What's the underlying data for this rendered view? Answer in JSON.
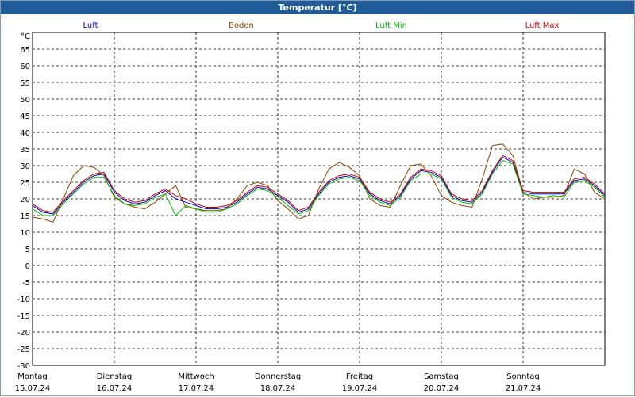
{
  "window": {
    "title": "Temperatur [°C]"
  },
  "chart_data": {
    "type": "line",
    "unit_label": "°C",
    "ylim": [
      -30,
      70
    ],
    "yticks": [
      65,
      60,
      55,
      50,
      45,
      40,
      35,
      30,
      25,
      20,
      15,
      10,
      5,
      0,
      -5,
      -10,
      -15,
      -20,
      -25,
      -30
    ],
    "xlim": [
      "2024-07-15",
      "2024-07-22"
    ],
    "x_ticks": [
      {
        "day": "Montag",
        "date": "15.07.24",
        "x": "2024-07-15"
      },
      {
        "day": "Dienstag",
        "date": "16.07.24",
        "x": "2024-07-16"
      },
      {
        "day": "Mittwoch",
        "date": "17.07.24",
        "x": "2024-07-17"
      },
      {
        "day": "Donnerstag",
        "date": "18.07.24",
        "x": "2024-07-18"
      },
      {
        "day": "Freitag",
        "date": "19.07.24",
        "x": "2024-07-19"
      },
      {
        "day": "Samstag",
        "date": "20.07.24",
        "x": "2024-07-20"
      },
      {
        "day": "Sonntag",
        "date": "21.07.24",
        "x": "2024-07-21"
      }
    ],
    "grid": true,
    "legend_position": "top",
    "series": [
      {
        "name": "Luft",
        "color": "#0000cc",
        "x": [
          "2024-07-15T00:00",
          "2024-07-15T03:00",
          "2024-07-15T06:00",
          "2024-07-15T09:00",
          "2024-07-15T12:00",
          "2024-07-15T15:00",
          "2024-07-15T18:00",
          "2024-07-15T21:00",
          "2024-07-16T00:00",
          "2024-07-16T03:00",
          "2024-07-16T06:00",
          "2024-07-16T09:00",
          "2024-07-16T12:00",
          "2024-07-16T15:00",
          "2024-07-16T18:00",
          "2024-07-16T21:00",
          "2024-07-17T00:00",
          "2024-07-17T03:00",
          "2024-07-17T06:00",
          "2024-07-17T09:00",
          "2024-07-17T12:00",
          "2024-07-17T15:00",
          "2024-07-17T18:00",
          "2024-07-17T21:00",
          "2024-07-18T00:00",
          "2024-07-18T03:00",
          "2024-07-18T06:00",
          "2024-07-18T09:00",
          "2024-07-18T12:00",
          "2024-07-18T15:00",
          "2024-07-18T18:00",
          "2024-07-18T21:00",
          "2024-07-19T00:00",
          "2024-07-19T03:00",
          "2024-07-19T06:00",
          "2024-07-19T09:00",
          "2024-07-19T12:00",
          "2024-07-19T15:00",
          "2024-07-19T18:00",
          "2024-07-19T21:00",
          "2024-07-20T00:00",
          "2024-07-20T03:00",
          "2024-07-20T06:00",
          "2024-07-20T09:00",
          "2024-07-20T12:00",
          "2024-07-20T15:00",
          "2024-07-20T18:00",
          "2024-07-20T21:00",
          "2024-07-21T00:00",
          "2024-07-21T03:00",
          "2024-07-21T06:00",
          "2024-07-21T09:00",
          "2024-07-21T12:00",
          "2024-07-21T15:00",
          "2024-07-21T18:00",
          "2024-07-21T21:00",
          "2024-07-22T00:00"
        ],
        "values": [
          18,
          16,
          15.5,
          19,
          22,
          25,
          27,
          27.5,
          22,
          19.5,
          18.5,
          19,
          21,
          22.5,
          20,
          19,
          18,
          17,
          17,
          17.5,
          19,
          21.5,
          23.5,
          23,
          21,
          19,
          16,
          17,
          21.5,
          25,
          26.5,
          27,
          26,
          21.5,
          19.5,
          18.5,
          21,
          26,
          28.5,
          28,
          26.5,
          21,
          19.5,
          19,
          22,
          28,
          32.5,
          31,
          22,
          21.5,
          21.5,
          21.5,
          21.5,
          25.5,
          26,
          24,
          21
        ]
      },
      {
        "name": "Boden",
        "color": "#8b4500",
        "x": [
          "2024-07-15T00:00",
          "2024-07-15T03:00",
          "2024-07-15T06:00",
          "2024-07-15T09:00",
          "2024-07-15T12:00",
          "2024-07-15T15:00",
          "2024-07-15T18:00",
          "2024-07-15T21:00",
          "2024-07-16T00:00",
          "2024-07-16T03:00",
          "2024-07-16T06:00",
          "2024-07-16T09:00",
          "2024-07-16T12:00",
          "2024-07-16T15:00",
          "2024-07-16T18:00",
          "2024-07-16T21:00",
          "2024-07-17T00:00",
          "2024-07-17T03:00",
          "2024-07-17T06:00",
          "2024-07-17T09:00",
          "2024-07-17T12:00",
          "2024-07-17T15:00",
          "2024-07-17T18:00",
          "2024-07-17T21:00",
          "2024-07-18T00:00",
          "2024-07-18T03:00",
          "2024-07-18T06:00",
          "2024-07-18T09:00",
          "2024-07-18T12:00",
          "2024-07-18T15:00",
          "2024-07-18T18:00",
          "2024-07-18T21:00",
          "2024-07-19T00:00",
          "2024-07-19T03:00",
          "2024-07-19T06:00",
          "2024-07-19T09:00",
          "2024-07-19T12:00",
          "2024-07-19T15:00",
          "2024-07-19T18:00",
          "2024-07-19T21:00",
          "2024-07-20T00:00",
          "2024-07-20T03:00",
          "2024-07-20T06:00",
          "2024-07-20T09:00",
          "2024-07-20T12:00",
          "2024-07-20T15:00",
          "2024-07-20T18:00",
          "2024-07-20T21:00",
          "2024-07-21T00:00",
          "2024-07-21T03:00",
          "2024-07-21T06:00",
          "2024-07-21T09:00",
          "2024-07-21T12:00",
          "2024-07-21T15:00",
          "2024-07-21T18:00",
          "2024-07-21T21:00",
          "2024-07-22T00:00"
        ],
        "values": [
          14.5,
          14,
          13,
          20,
          27,
          30,
          29.5,
          27,
          20.5,
          18.5,
          17.5,
          17,
          19,
          21.5,
          24,
          17.5,
          17,
          16.5,
          16.5,
          17,
          20,
          24,
          25,
          24,
          19.5,
          17,
          14,
          15,
          23,
          29,
          31,
          29.5,
          27,
          20,
          18,
          17.5,
          24,
          30,
          30.5,
          27,
          21,
          19,
          18,
          17.5,
          26,
          36,
          36.5,
          33,
          22,
          20,
          20.5,
          20.5,
          21,
          29,
          27.5,
          22,
          20
        ]
      },
      {
        "name": "Luft Min",
        "color": "#00bb00",
        "x": [
          "2024-07-15T00:00",
          "2024-07-15T03:00",
          "2024-07-15T06:00",
          "2024-07-15T09:00",
          "2024-07-15T12:00",
          "2024-07-15T15:00",
          "2024-07-15T18:00",
          "2024-07-15T21:00",
          "2024-07-16T00:00",
          "2024-07-16T03:00",
          "2024-07-16T06:00",
          "2024-07-16T09:00",
          "2024-07-16T12:00",
          "2024-07-16T15:00",
          "2024-07-16T18:00",
          "2024-07-16T21:00",
          "2024-07-17T00:00",
          "2024-07-17T03:00",
          "2024-07-17T06:00",
          "2024-07-17T09:00",
          "2024-07-17T12:00",
          "2024-07-17T15:00",
          "2024-07-17T18:00",
          "2024-07-17T21:00",
          "2024-07-18T00:00",
          "2024-07-18T03:00",
          "2024-07-18T06:00",
          "2024-07-18T09:00",
          "2024-07-18T12:00",
          "2024-07-18T15:00",
          "2024-07-18T18:00",
          "2024-07-18T21:00",
          "2024-07-19T00:00",
          "2024-07-19T03:00",
          "2024-07-19T06:00",
          "2024-07-19T09:00",
          "2024-07-19T12:00",
          "2024-07-19T15:00",
          "2024-07-19T18:00",
          "2024-07-19T21:00",
          "2024-07-20T00:00",
          "2024-07-20T03:00",
          "2024-07-20T06:00",
          "2024-07-20T09:00",
          "2024-07-20T12:00",
          "2024-07-20T15:00",
          "2024-07-20T18:00",
          "2024-07-20T21:00",
          "2024-07-21T00:00",
          "2024-07-21T03:00",
          "2024-07-21T06:00",
          "2024-07-21T09:00",
          "2024-07-21T12:00",
          "2024-07-21T15:00",
          "2024-07-21T18:00",
          "2024-07-21T21:00",
          "2024-07-22T00:00"
        ],
        "values": [
          17,
          15,
          15,
          18.5,
          21.5,
          24.5,
          26.5,
          26.5,
          21,
          18.5,
          18,
          18.5,
          20.5,
          21.5,
          15,
          18,
          17,
          16,
          16,
          17,
          18.5,
          21,
          23,
          22.5,
          20.5,
          18,
          15.5,
          16.5,
          21,
          24.5,
          26,
          26.5,
          25.5,
          21,
          19,
          18,
          20.5,
          25.5,
          27.5,
          27.5,
          26,
          20.5,
          19,
          18.5,
          21.5,
          27.5,
          31.5,
          30.5,
          21.5,
          21,
          20.5,
          21,
          20.5,
          25,
          25.5,
          23.5,
          20.5
        ]
      },
      {
        "name": "Luft Max",
        "color": "#cc0000",
        "x": [
          "2024-07-15T00:00",
          "2024-07-15T03:00",
          "2024-07-15T06:00",
          "2024-07-15T09:00",
          "2024-07-15T12:00",
          "2024-07-15T15:00",
          "2024-07-15T18:00",
          "2024-07-15T21:00",
          "2024-07-16T00:00",
          "2024-07-16T03:00",
          "2024-07-16T06:00",
          "2024-07-16T09:00",
          "2024-07-16T12:00",
          "2024-07-16T15:00",
          "2024-07-16T18:00",
          "2024-07-16T21:00",
          "2024-07-17T00:00",
          "2024-07-17T03:00",
          "2024-07-17T06:00",
          "2024-07-17T09:00",
          "2024-07-17T12:00",
          "2024-07-17T15:00",
          "2024-07-17T18:00",
          "2024-07-17T21:00",
          "2024-07-18T00:00",
          "2024-07-18T03:00",
          "2024-07-18T06:00",
          "2024-07-18T09:00",
          "2024-07-18T12:00",
          "2024-07-18T15:00",
          "2024-07-18T18:00",
          "2024-07-18T21:00",
          "2024-07-19T00:00",
          "2024-07-19T03:00",
          "2024-07-19T06:00",
          "2024-07-19T09:00",
          "2024-07-19T12:00",
          "2024-07-19T15:00",
          "2024-07-19T18:00",
          "2024-07-19T21:00",
          "2024-07-20T00:00",
          "2024-07-20T03:00",
          "2024-07-20T06:00",
          "2024-07-20T09:00",
          "2024-07-20T12:00",
          "2024-07-20T15:00",
          "2024-07-20T18:00",
          "2024-07-20T21:00",
          "2024-07-21T00:00",
          "2024-07-21T03:00",
          "2024-07-21T06:00",
          "2024-07-21T09:00",
          "2024-07-21T12:00",
          "2024-07-21T15:00",
          "2024-07-21T18:00",
          "2024-07-21T21:00",
          "2024-07-22T00:00"
        ],
        "values": [
          18.5,
          16.5,
          16,
          19.5,
          22.5,
          25.5,
          27.5,
          28,
          22.5,
          20,
          19,
          19.5,
          21.5,
          23,
          21,
          20,
          18.5,
          17.5,
          17.5,
          18,
          19.5,
          22,
          24,
          23.5,
          21.5,
          19.5,
          16.5,
          17.5,
          22,
          25.5,
          27,
          27.5,
          26.5,
          22,
          20,
          19,
          21.5,
          26.5,
          29,
          28.5,
          27,
          21.5,
          20,
          19.5,
          22.5,
          28.5,
          33,
          31.5,
          22.5,
          22,
          22,
          22,
          22,
          26,
          26.5,
          24.5,
          21.5
        ]
      }
    ]
  }
}
